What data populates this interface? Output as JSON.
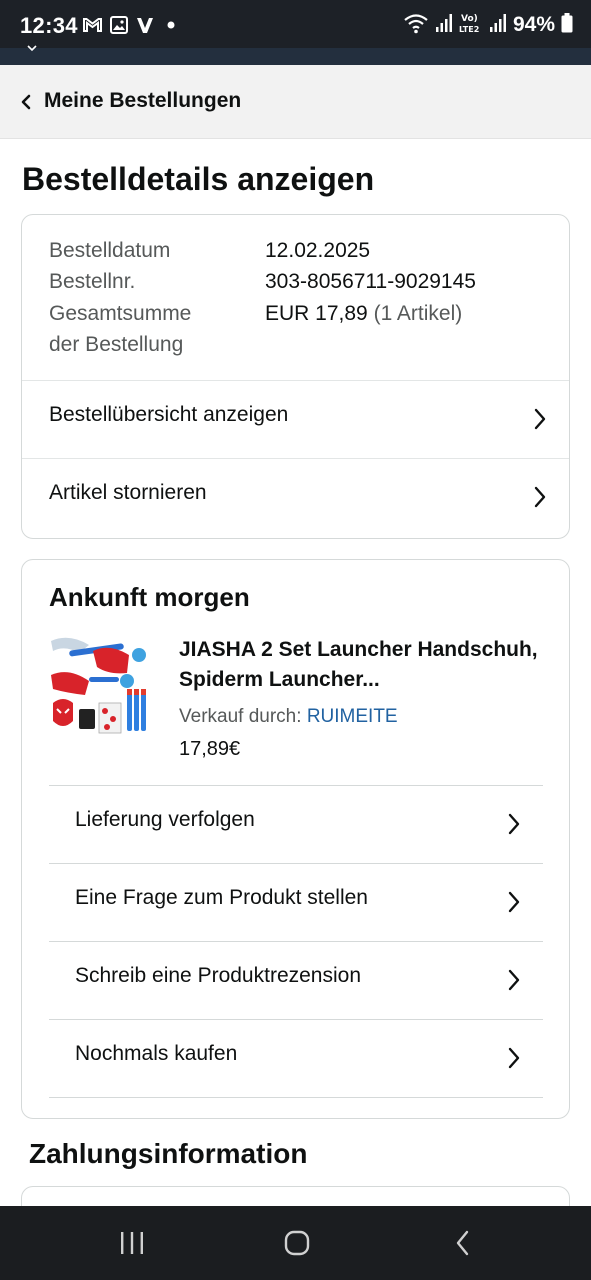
{
  "status_bar": {
    "time": "12:34",
    "battery": "94%",
    "icons": [
      "gmail-icon",
      "gallery-icon",
      "v-app-icon",
      "dot-icon",
      "wifi-icon",
      "signal-icon",
      "volte-icon",
      "signal-icon-2",
      "battery-icon"
    ]
  },
  "header": {
    "back_label": "Meine Bestellungen"
  },
  "page": {
    "title": "Bestelldetails anzeigen"
  },
  "order_summary": {
    "fields": [
      {
        "label": "Bestelldatum",
        "value": "12.02.2025"
      },
      {
        "label": "Bestellnr.",
        "value": "303-8056711-9029145"
      },
      {
        "label_line1": "Gesamtsumme",
        "label_line2": "der Bestellung",
        "value": "EUR 17,89",
        "value_extra": "(1 Artikel)"
      }
    ],
    "actions": [
      {
        "label": "Bestellübersicht anzeigen"
      },
      {
        "label": "Artikel stornieren"
      }
    ]
  },
  "shipment": {
    "title": "Ankunft morgen",
    "product": {
      "title": "JIASHA 2 Set Launcher Handschuh, Spiderm Launcher...",
      "seller_prefix": "Verkauf durch:",
      "seller_name": "RUIMEITE",
      "price": "17,89€"
    },
    "actions": [
      {
        "label": "Lieferung verfolgen"
      },
      {
        "label": "Eine Frage zum Produkt stellen"
      },
      {
        "label": "Schreib eine Produktrezension"
      },
      {
        "label": "Nochmals kaufen"
      }
    ]
  },
  "payment": {
    "title": "Zahlungsinformation"
  },
  "colors": {
    "link": "#2162a1",
    "text": "#0f1111",
    "muted": "#565959",
    "header_bg": "#f2f2f2"
  }
}
